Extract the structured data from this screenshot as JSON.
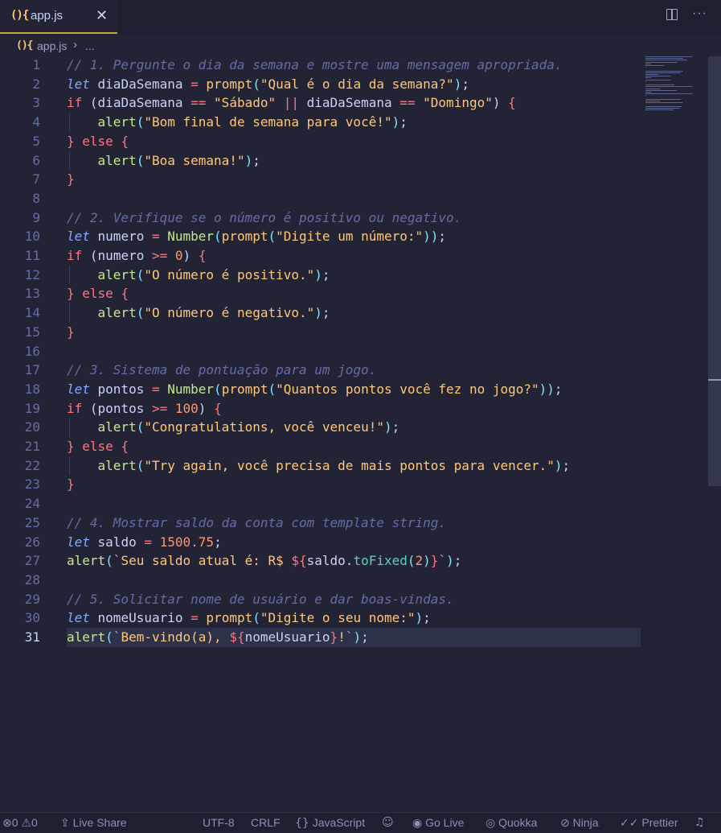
{
  "tab": {
    "icon_text": "(){",
    "label": "app.js",
    "close_glyph": "✕",
    "more_glyph": "···"
  },
  "breadcrumb": {
    "icon_text": "(){",
    "file": "app.js",
    "separator": "›",
    "rest": "..."
  },
  "editor": {
    "active_line": 31,
    "lines": [
      {
        "n": "1",
        "tokens": [
          [
            "cm",
            "// 1. Pergunte o dia da semana e mostre uma mensagem apropriada."
          ]
        ]
      },
      {
        "n": "2",
        "tokens": [
          [
            "let",
            "let"
          ],
          [
            "var",
            " diaDaSemana "
          ],
          [
            "op",
            "="
          ],
          [
            "var",
            " "
          ],
          [
            "fnb",
            "prompt"
          ],
          [
            "p",
            "("
          ],
          [
            "str",
            "\"Qual é o dia da semana?\""
          ],
          [
            "p",
            ")"
          ],
          [
            "var",
            ";"
          ]
        ]
      },
      {
        "n": "3",
        "tokens": [
          [
            "kw",
            "if"
          ],
          [
            "var",
            " "
          ],
          [
            "pb",
            "("
          ],
          [
            "var",
            "diaDaSemana "
          ],
          [
            "op",
            "=="
          ],
          [
            "var",
            " "
          ],
          [
            "str",
            "\"Sábado\""
          ],
          [
            "var",
            " "
          ],
          [
            "op",
            "||"
          ],
          [
            "var",
            " diaDaSemana "
          ],
          [
            "op",
            "=="
          ],
          [
            "var",
            " "
          ],
          [
            "str",
            "\"Domingo\""
          ],
          [
            "pb",
            ")"
          ],
          [
            "var",
            " "
          ],
          [
            "kw",
            "{"
          ]
        ]
      },
      {
        "n": "4",
        "tokens": [
          [
            "var",
            "    "
          ],
          [
            "fn",
            "alert"
          ],
          [
            "p",
            "("
          ],
          [
            "str",
            "\"Bom final de semana para você!\""
          ],
          [
            "p",
            ")"
          ],
          [
            "var",
            ";"
          ]
        ]
      },
      {
        "n": "5",
        "tokens": [
          [
            "kw",
            "}"
          ],
          [
            "var",
            " "
          ],
          [
            "kw",
            "else"
          ],
          [
            "var",
            " "
          ],
          [
            "kw",
            "{"
          ]
        ]
      },
      {
        "n": "6",
        "tokens": [
          [
            "var",
            "    "
          ],
          [
            "fn",
            "alert"
          ],
          [
            "p",
            "("
          ],
          [
            "str",
            "\"Boa semana!\""
          ],
          [
            "p",
            ")"
          ],
          [
            "var",
            ";"
          ]
        ]
      },
      {
        "n": "7",
        "tokens": [
          [
            "kw",
            "}"
          ]
        ]
      },
      {
        "n": "8",
        "tokens": []
      },
      {
        "n": "9",
        "tokens": [
          [
            "cm",
            "// 2. Verifique se o número é positivo ou negativo."
          ]
        ]
      },
      {
        "n": "10",
        "tokens": [
          [
            "let",
            "let"
          ],
          [
            "var",
            " numero "
          ],
          [
            "op",
            "="
          ],
          [
            "var",
            " "
          ],
          [
            "fn",
            "Number"
          ],
          [
            "p",
            "("
          ],
          [
            "fnb",
            "prompt"
          ],
          [
            "p",
            "("
          ],
          [
            "str",
            "\"Digite um número:\""
          ],
          [
            "p",
            "))"
          ],
          [
            "var",
            ";"
          ]
        ]
      },
      {
        "n": "11",
        "tokens": [
          [
            "kw",
            "if"
          ],
          [
            "var",
            " "
          ],
          [
            "pb",
            "("
          ],
          [
            "var",
            "numero "
          ],
          [
            "op",
            ">="
          ],
          [
            "var",
            " "
          ],
          [
            "num",
            "0"
          ],
          [
            "pb",
            ")"
          ],
          [
            "var",
            " "
          ],
          [
            "kw",
            "{"
          ]
        ]
      },
      {
        "n": "12",
        "tokens": [
          [
            "var",
            "    "
          ],
          [
            "fn",
            "alert"
          ],
          [
            "p",
            "("
          ],
          [
            "str",
            "\"O número é positivo.\""
          ],
          [
            "p",
            ")"
          ],
          [
            "var",
            ";"
          ]
        ]
      },
      {
        "n": "13",
        "tokens": [
          [
            "kw",
            "}"
          ],
          [
            "var",
            " "
          ],
          [
            "kw",
            "else"
          ],
          [
            "var",
            " "
          ],
          [
            "kw",
            "{"
          ]
        ]
      },
      {
        "n": "14",
        "tokens": [
          [
            "var",
            "    "
          ],
          [
            "fn",
            "alert"
          ],
          [
            "p",
            "("
          ],
          [
            "str",
            "\"O número é negativo.\""
          ],
          [
            "p",
            ")"
          ],
          [
            "var",
            ";"
          ]
        ]
      },
      {
        "n": "15",
        "tokens": [
          [
            "kw",
            "}"
          ]
        ]
      },
      {
        "n": "16",
        "tokens": []
      },
      {
        "n": "17",
        "tokens": [
          [
            "cm",
            "// 3. Sistema de pontuação para um jogo."
          ]
        ]
      },
      {
        "n": "18",
        "tokens": [
          [
            "let",
            "let"
          ],
          [
            "var",
            " pontos "
          ],
          [
            "op",
            "="
          ],
          [
            "var",
            " "
          ],
          [
            "fn",
            "Number"
          ],
          [
            "p",
            "("
          ],
          [
            "fnb",
            "prompt"
          ],
          [
            "p",
            "("
          ],
          [
            "str",
            "\"Quantos pontos você fez no jogo?\""
          ],
          [
            "p",
            "))"
          ],
          [
            "var",
            ";"
          ]
        ]
      },
      {
        "n": "19",
        "tokens": [
          [
            "kw",
            "if"
          ],
          [
            "var",
            " "
          ],
          [
            "pb",
            "("
          ],
          [
            "var",
            "pontos "
          ],
          [
            "op",
            ">="
          ],
          [
            "var",
            " "
          ],
          [
            "num",
            "100"
          ],
          [
            "pb",
            ")"
          ],
          [
            "var",
            " "
          ],
          [
            "kw",
            "{"
          ]
        ]
      },
      {
        "n": "20",
        "tokens": [
          [
            "var",
            "    "
          ],
          [
            "fn",
            "alert"
          ],
          [
            "p",
            "("
          ],
          [
            "str",
            "\"Congratulations, você venceu!\""
          ],
          [
            "p",
            ")"
          ],
          [
            "var",
            ";"
          ]
        ]
      },
      {
        "n": "21",
        "tokens": [
          [
            "kw",
            "}"
          ],
          [
            "var",
            " "
          ],
          [
            "kw",
            "else"
          ],
          [
            "var",
            " "
          ],
          [
            "kw",
            "{"
          ]
        ]
      },
      {
        "n": "22",
        "tokens": [
          [
            "var",
            "    "
          ],
          [
            "fn",
            "alert"
          ],
          [
            "p",
            "("
          ],
          [
            "str",
            "\"Try again, você precisa de mais pontos para vencer.\""
          ],
          [
            "p",
            ")"
          ],
          [
            "var",
            ";"
          ]
        ]
      },
      {
        "n": "23",
        "tokens": [
          [
            "kw",
            "}"
          ]
        ]
      },
      {
        "n": "24",
        "tokens": []
      },
      {
        "n": "25",
        "tokens": [
          [
            "cm",
            "// 4. Mostrar saldo da conta com template string."
          ]
        ]
      },
      {
        "n": "26",
        "tokens": [
          [
            "let",
            "let"
          ],
          [
            "var",
            " saldo "
          ],
          [
            "op",
            "="
          ],
          [
            "var",
            " "
          ],
          [
            "num",
            "1500.75"
          ],
          [
            "var",
            ";"
          ]
        ]
      },
      {
        "n": "27",
        "tokens": [
          [
            "fn",
            "alert"
          ],
          [
            "p",
            "("
          ],
          [
            "q",
            "`"
          ],
          [
            "str",
            "Seu saldo atual é: R$ "
          ],
          [
            "op",
            "${"
          ],
          [
            "var",
            "saldo."
          ],
          [
            "meth",
            "toFixed"
          ],
          [
            "p",
            "("
          ],
          [
            "num",
            "2"
          ],
          [
            "p",
            ")"
          ],
          [
            "op",
            "}"
          ],
          [
            "q",
            "`"
          ],
          [
            "p",
            ")"
          ],
          [
            "var",
            ";"
          ]
        ]
      },
      {
        "n": "28",
        "tokens": []
      },
      {
        "n": "29",
        "tokens": [
          [
            "cm",
            "// 5. Solicitar nome de usuário e dar boas-vindas."
          ]
        ]
      },
      {
        "n": "30",
        "tokens": [
          [
            "let",
            "let"
          ],
          [
            "var",
            " nomeUsuario "
          ],
          [
            "op",
            "="
          ],
          [
            "var",
            " "
          ],
          [
            "fnb",
            "prompt"
          ],
          [
            "p",
            "("
          ],
          [
            "str",
            "\"Digite o seu nome:\""
          ],
          [
            "p",
            ")"
          ],
          [
            "var",
            ";"
          ]
        ]
      },
      {
        "n": "31",
        "tokens": [
          [
            "fn",
            "alert"
          ],
          [
            "p",
            "("
          ],
          [
            "q",
            "`"
          ],
          [
            "str",
            "Bem-vindo(a), "
          ],
          [
            "op",
            "${"
          ],
          [
            "var",
            "nomeUsuario"
          ],
          [
            "op",
            "}"
          ],
          [
            "str",
            "!"
          ],
          [
            "q",
            "`"
          ],
          [
            "p",
            ")"
          ],
          [
            "var",
            ";"
          ]
        ]
      }
    ]
  },
  "statusbar": {
    "errors_icon": "⊗",
    "errors": "0",
    "warnings_icon": "⚠",
    "warnings": "0",
    "live_share_icon": "⇪",
    "live_share": "Live Share",
    "encoding": "UTF-8",
    "eol": "CRLF",
    "language_icon": "{}",
    "language": "JavaScript",
    "copilot_icon": "☺",
    "go_live_icon": "◉",
    "go_live": "Go Live",
    "quokka_icon": "◎",
    "quokka": "Quokka",
    "ninja_icon": "⊘",
    "ninja": "Ninja",
    "prettier_icon": "✓✓",
    "prettier": "Prettier",
    "bell_icon": "♫"
  },
  "colors": {
    "background": "#222436",
    "comment": "#636da6",
    "keyword": "#ff757f",
    "string": "#ffc777",
    "function": "#c3e88d",
    "let": "#82aaff"
  }
}
